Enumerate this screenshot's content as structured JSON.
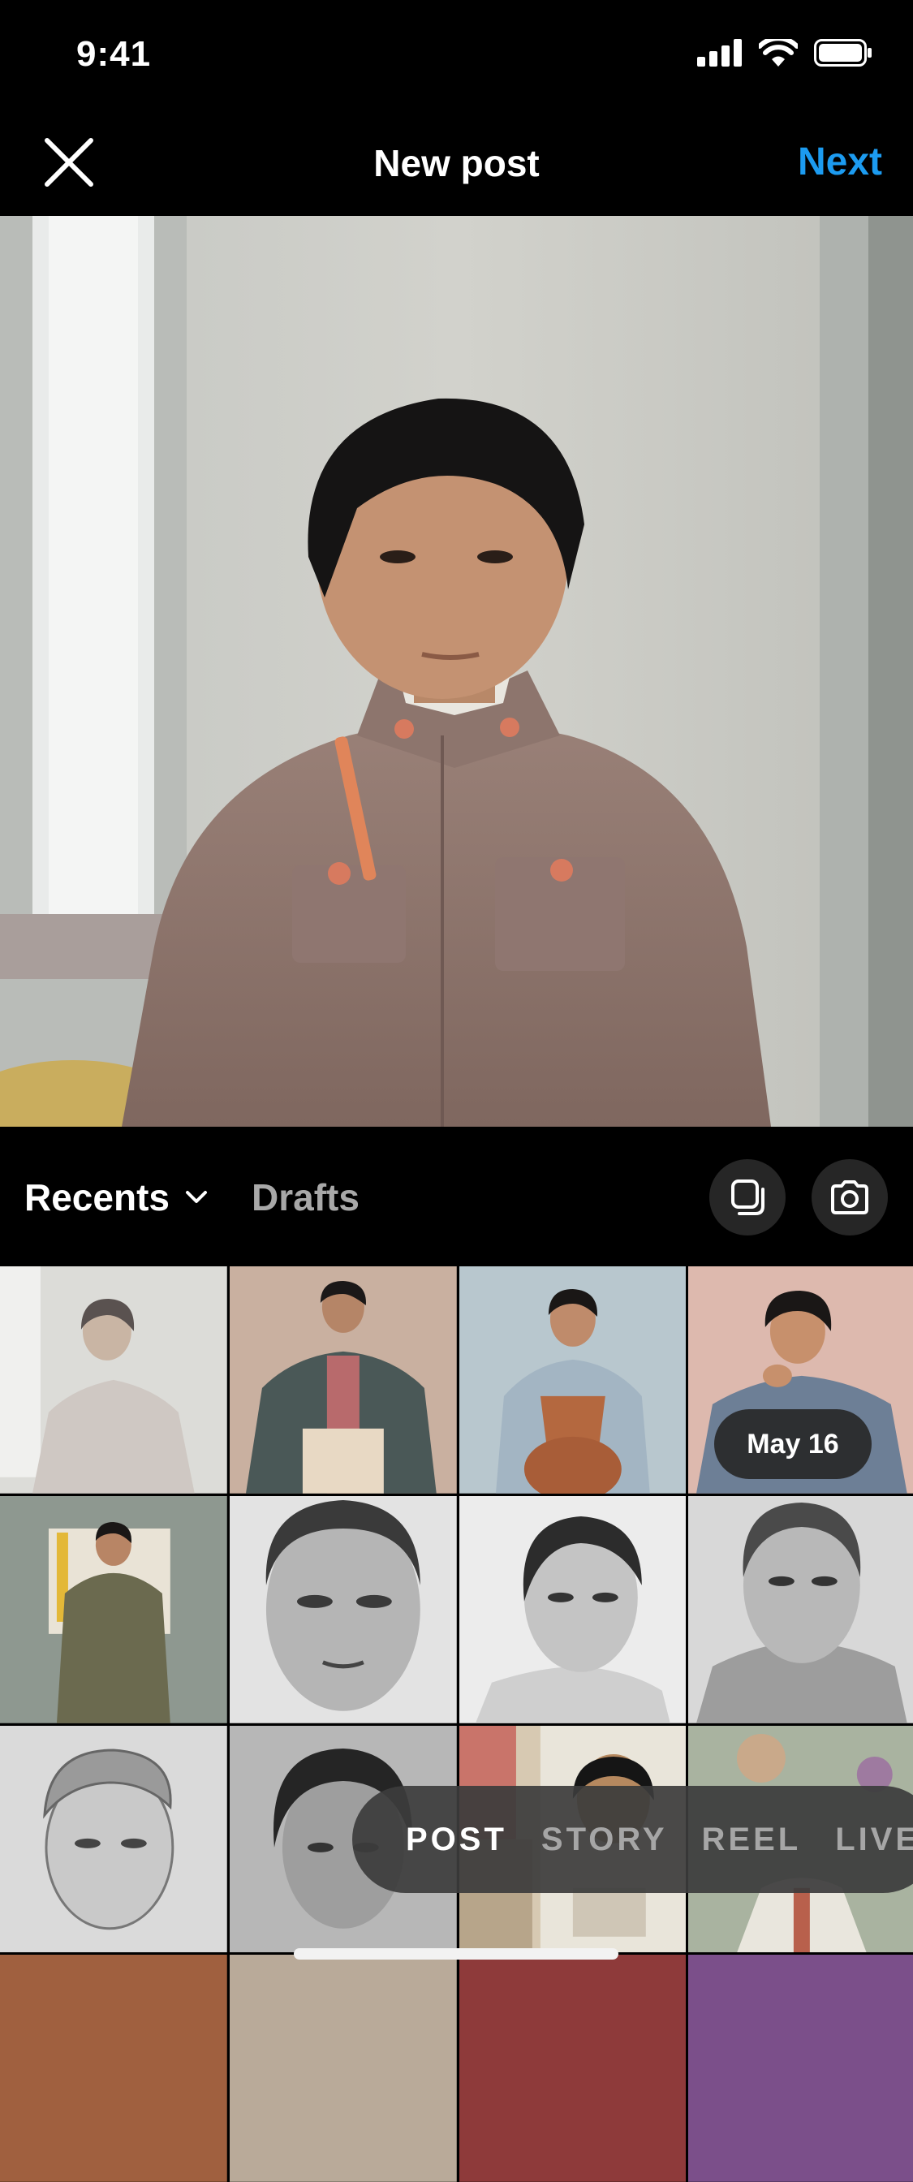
{
  "status": {
    "time": "9:41"
  },
  "header": {
    "title": "New post",
    "next_label": "Next"
  },
  "gallery": {
    "album_label": "Recents",
    "drafts_label": "Drafts",
    "date_badge": "May 16"
  },
  "modes": [
    {
      "label": "POST",
      "active": true
    },
    {
      "label": "STORY",
      "active": false
    },
    {
      "label": "REEL",
      "active": false
    },
    {
      "label": "LIVE",
      "active": false
    }
  ],
  "colors": {
    "accent": "#1c9bf0",
    "background": "#000000"
  }
}
